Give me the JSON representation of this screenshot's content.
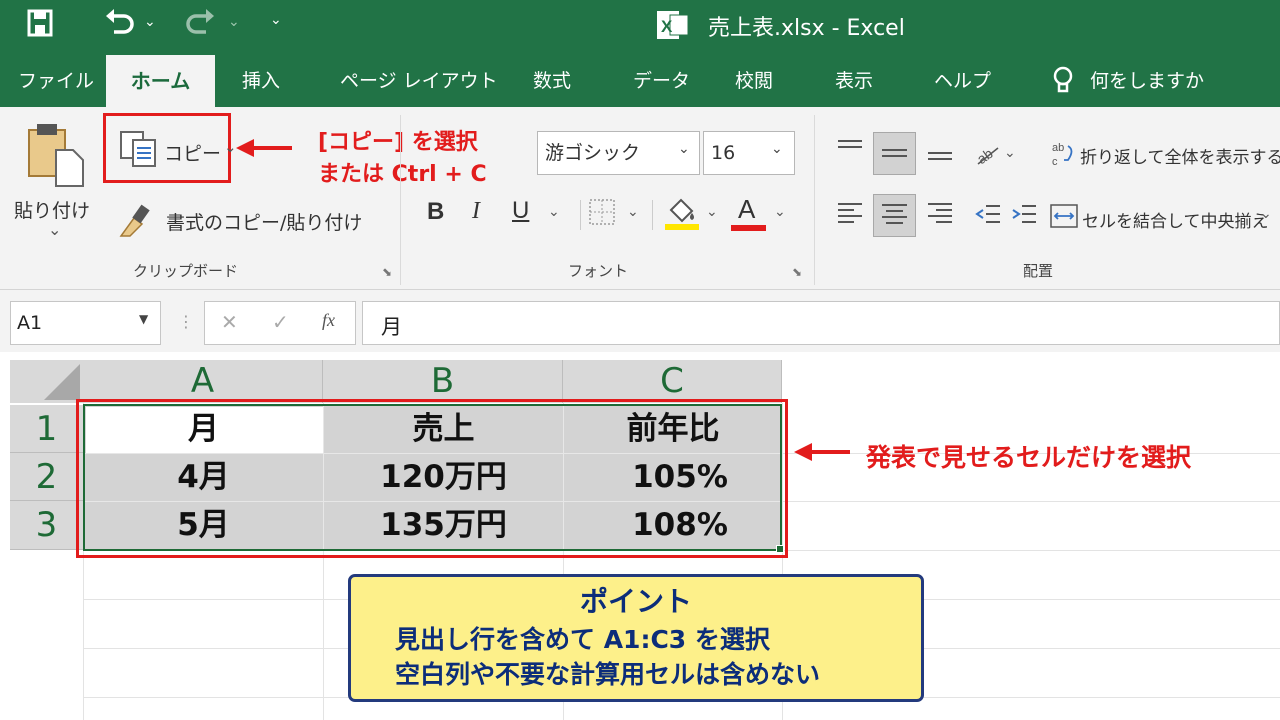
{
  "window": {
    "title": "売上表.xlsx - Excel"
  },
  "quick_access": {
    "save_icon": "save-icon",
    "undo_icon": "undo-icon",
    "redo_icon": "redo-icon",
    "customize_icon": "customize-icon"
  },
  "tabs": [
    "ファイル",
    "ホーム",
    "挿入",
    "ページ レイアウト",
    "数式",
    "データ",
    "校閲",
    "表示",
    "ヘルプ"
  ],
  "tell_me": "何をしますか",
  "ribbon": {
    "clipboard": {
      "paste_label": "貼り付け",
      "copy_label": "コピー",
      "format_painter_label": "書式のコピー/貼り付け",
      "group_label": "クリップボード"
    },
    "font": {
      "font_name": "游ゴシック",
      "font_size": "16",
      "bold": "B",
      "italic": "I",
      "underline": "U",
      "font_color": "A",
      "group_label": "フォント"
    },
    "alignment": {
      "wrap_text": "折り返して全体を表示する",
      "merge_center": "セルを結合して中央揃え",
      "group_label": "配置"
    }
  },
  "callouts": {
    "copy_line1": "[コピー] を選択",
    "copy_line2": "または Ctrl + C",
    "select_cells": "発表で見せるセルだけを選択"
  },
  "formula_bar": {
    "name_box": "A1",
    "cancel": "✕",
    "enter": "✓",
    "fx": "fx",
    "content": "月"
  },
  "sheet": {
    "columns": [
      "A",
      "B",
      "C"
    ],
    "rows": [
      "1",
      "2",
      "3"
    ],
    "cells": [
      [
        "月",
        "売上",
        "前年比"
      ],
      [
        "4月",
        "120万円",
        "105%"
      ],
      [
        "5月",
        "135万円",
        "108%"
      ]
    ]
  },
  "point_box": {
    "title": "ポイント",
    "line1": "見出し行を含めて A1:C3 を選択",
    "line2": "空白列や不要な計算用セルは含めない"
  },
  "colors": {
    "excel_green": "#217346",
    "callout_red": "#e21c1c",
    "point_bg": "#fdf08a",
    "point_border": "#233a7d"
  }
}
